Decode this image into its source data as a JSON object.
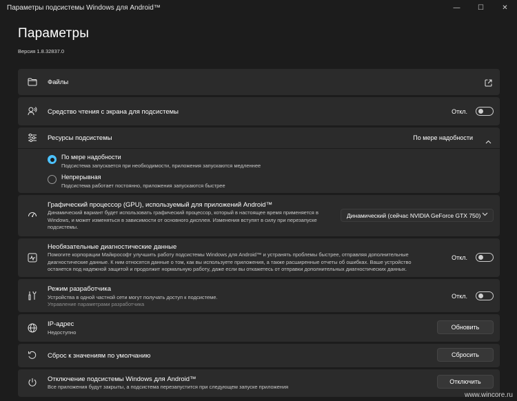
{
  "window": {
    "title": "Параметры подсистемы Windows для Android™",
    "minimize": "—",
    "maximize": "☐",
    "close": "✕"
  },
  "header": {
    "title": "Параметры",
    "version": "Версия 1.8.32837.0"
  },
  "files": {
    "label": "Файлы",
    "icon": "folder-icon",
    "action_icon": "external-link-icon"
  },
  "screen_reader": {
    "label": "Средство чтения с экрана для подсистемы",
    "toggle_text": "Откл.",
    "toggle_on": false
  },
  "resources": {
    "label": "Ресурсы подсистемы",
    "selected_value": "По мере надобности",
    "expanded": true,
    "options": [
      {
        "label": "По мере надобности",
        "desc": "Подсистема запускается при необходимости, приложения запускаются медленнее",
        "selected": true
      },
      {
        "label": "Непрерывная",
        "desc": "Подсистема работает постоянно, приложения запускаются быстрее",
        "selected": false
      }
    ]
  },
  "gpu": {
    "label": "Графический процессор (GPU), используемый для приложений Android™",
    "desc1": "Динамический вариант будет использовать графический процессор, который в настоящее время применяется в",
    "desc2": "Windows, и может изменяться в зависимости от основного дисплея. Изменения вступят в силу при перезапуске",
    "desc3": "подсистемы.",
    "dropdown_value": "Динамический (сейчас NVIDIA GeForce GTX 750)"
  },
  "diagnostics": {
    "label": "Необязательные диагностические данные",
    "desc1": "Помогите корпорации Майкрософт улучшить работу подсистемы Windows для Android™ и устранять проблемы быстрее, отправляя дополнительные",
    "desc2": "диагностические данные. К ним относятся данные о том, как вы используете приложения, а также расширенные отчеты об ошибках. Ваше устройство",
    "desc3": "останется под надежной защитой и продолжит нормальную работу, даже если вы откажетесь от отправки дополнительных диагностических данных.",
    "toggle_text": "Откл.",
    "toggle_on": false
  },
  "developer": {
    "label": "Режим разработчика",
    "desc": "Устройства в одной частной сети могут получать доступ к подсистеме.",
    "link": "Управление параметрами разработчика",
    "toggle_text": "Откл.",
    "toggle_on": false
  },
  "ip": {
    "label": "IP-адрес",
    "value": "Недоступно",
    "button": "Обновить"
  },
  "reset": {
    "label": "Сброс к значениям по умолчанию",
    "button": "Сбросить"
  },
  "shutdown": {
    "label": "Отключение подсистемы Windows для Android™",
    "desc": "Все приложения будут закрыты, а подсистема перезапустится при следующем запуске приложения",
    "button": "Отключить"
  },
  "watermark": "www.wincore.ru"
}
